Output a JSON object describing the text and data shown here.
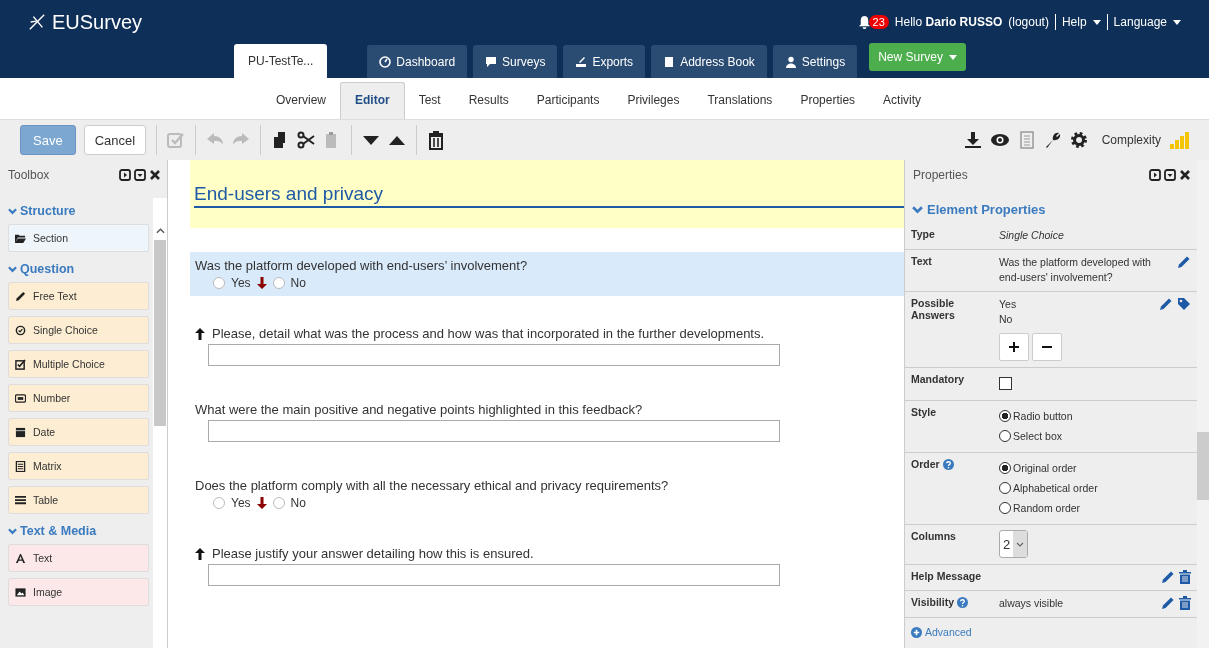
{
  "header": {
    "logo": "EUSurvey",
    "notifications": "23",
    "greeting": "Hello",
    "user": "Dario RUSSO",
    "logout": "(logout)",
    "help": "Help",
    "language": "Language"
  },
  "survey_tab": "PU-TestTe...",
  "nav": [
    {
      "label": "Dashboard",
      "kind": "dashboard"
    },
    {
      "label": "Surveys",
      "kind": "surveys"
    },
    {
      "label": "Exports",
      "kind": "exports"
    },
    {
      "label": "Address Book",
      "kind": "book"
    },
    {
      "label": "Settings",
      "kind": "settings"
    }
  ],
  "new_survey": "New Survey",
  "subnav": [
    {
      "label": "Overview",
      "selected": false
    },
    {
      "label": "Editor",
      "selected": true
    },
    {
      "label": "Test",
      "selected": false
    },
    {
      "label": "Results",
      "selected": false
    },
    {
      "label": "Participants",
      "selected": false
    },
    {
      "label": "Privileges",
      "selected": false
    },
    {
      "label": "Translations",
      "selected": false
    },
    {
      "label": "Properties",
      "selected": false
    },
    {
      "label": "Activity",
      "selected": false
    }
  ],
  "toolbar": {
    "save": "Save",
    "cancel": "Cancel",
    "complexity": "Complexity"
  },
  "toolbox": {
    "title": "Toolbox",
    "groups": [
      {
        "title": "Structure",
        "kind": "structure",
        "items": [
          {
            "label": "Section",
            "kind": "folder"
          }
        ]
      },
      {
        "title": "Question",
        "kind": "question",
        "items": [
          {
            "label": "Free Text",
            "kind": "pencil"
          },
          {
            "label": "Single Choice",
            "kind": "radio"
          },
          {
            "label": "Multiple Choice",
            "kind": "check"
          },
          {
            "label": "Number",
            "kind": "number"
          },
          {
            "label": "Date",
            "kind": "calendar"
          },
          {
            "label": "Matrix",
            "kind": "matrix"
          },
          {
            "label": "Table",
            "kind": "table"
          }
        ]
      },
      {
        "title": "Text & Media",
        "kind": "media",
        "items": [
          {
            "label": "Text",
            "kind": "letter"
          },
          {
            "label": "Image",
            "kind": "image"
          }
        ]
      }
    ]
  },
  "survey": {
    "section_title": "End-users and privacy",
    "questions": [
      {
        "kind": "choice",
        "selected": true,
        "dependent": false,
        "text": "Was the platform developed with end-users’ involvement?",
        "options": [
          {
            "label": "Yes",
            "selected": false,
            "triggers": true
          },
          {
            "label": "No",
            "selected": false,
            "triggers": false
          }
        ]
      },
      {
        "kind": "text",
        "selected": false,
        "dependent": true,
        "text": "Please, detail what was the process and how was that incorporated in the further developments."
      },
      {
        "kind": "text",
        "selected": false,
        "dependent": false,
        "text": "What were the main positive and negative points highlighted in this feedback?"
      },
      {
        "kind": "choice",
        "selected": false,
        "dependent": false,
        "text": "Does the platform comply with all the necessary ethical and privacy requirements?",
        "options": [
          {
            "label": "Yes",
            "selected": false,
            "triggers": true
          },
          {
            "label": "No",
            "selected": false,
            "triggers": false
          }
        ]
      },
      {
        "kind": "text",
        "selected": false,
        "dependent": true,
        "text": "Please justify your answer detailing how this is ensured."
      }
    ]
  },
  "properties": {
    "title": "Properties",
    "header": "Element Properties",
    "rows": [
      {
        "kind": "italic",
        "label": "Type",
        "value": "Single Choice"
      },
      {
        "kind": "text",
        "label": "Text",
        "value": "Was the platform developed with end-users' involvement?",
        "edit": true
      },
      {
        "kind": "answers",
        "label": "Possible Answers",
        "answers": [
          "Yes",
          "No"
        ],
        "edit": true
      },
      {
        "kind": "checkbox",
        "label": "Mandatory",
        "checked": false
      },
      {
        "kind": "radio",
        "label": "Style",
        "options": [
          {
            "label": "Radio button",
            "selected": true
          },
          {
            "label": "Select box",
            "selected": false
          }
        ]
      },
      {
        "kind": "radio",
        "label": "Order",
        "help": true,
        "options": [
          {
            "label": "Original order",
            "selected": true
          },
          {
            "label": "Alphabetical order",
            "selected": false
          },
          {
            "label": "Random order",
            "selected": false
          }
        ]
      },
      {
        "kind": "select",
        "label": "Columns",
        "value": "2"
      },
      {
        "kind": "actions",
        "label": "Help Message"
      },
      {
        "kind": "actions",
        "label": "Visibility",
        "help": true,
        "value": "always visible"
      }
    ],
    "advanced": "Advanced"
  }
}
